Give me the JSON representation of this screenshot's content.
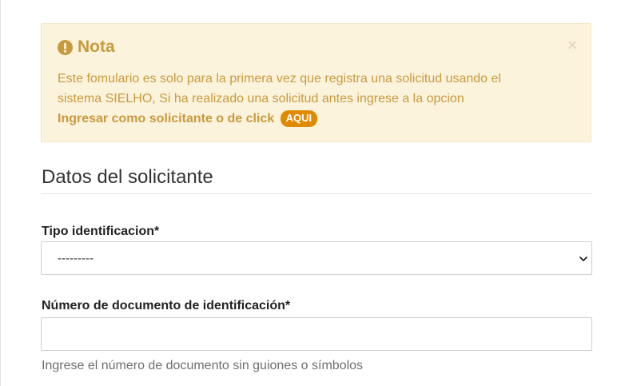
{
  "alert": {
    "title": "Nota",
    "close_symbol": "×",
    "icon": "exclamation-circle-icon",
    "line1": "Este fomulario es solo para la primera vez que registra una solicitud usando el",
    "line2": "sistema SIELHO, Si ha realizado una solicitud antes ingrese a la opcion",
    "line3": "Ingresar como solicitante o de click",
    "link_badge": "AQUI",
    "colors": {
      "background": "#fcf3dc",
      "text": "#c89a3e",
      "badge": "#e08a00"
    }
  },
  "section": {
    "title": "Datos del solicitante"
  },
  "form": {
    "tipo_identificacion": {
      "label": "Tipo identificacion*",
      "selected": "---------"
    },
    "numero_documento": {
      "label": "Número de documento de identificación*",
      "value": "",
      "help": "Ingrese el número de documento sin guiones o símbolos"
    }
  }
}
